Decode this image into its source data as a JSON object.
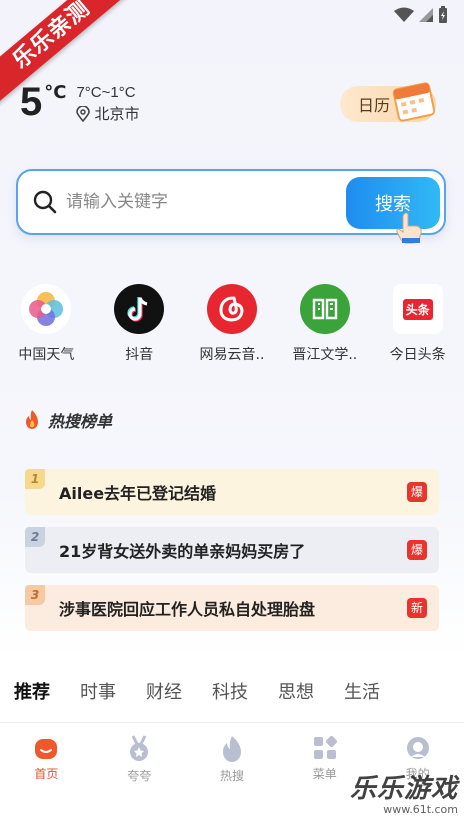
{
  "ribbon": {
    "text": "乐乐亲测"
  },
  "weather": {
    "temp": "5",
    "unit": "°C",
    "range": "7°C~1°C",
    "city": "北京市"
  },
  "calendar": {
    "label": "日历"
  },
  "search": {
    "placeholder": "请输入关键字",
    "button": "搜索"
  },
  "apps": [
    {
      "label": "中国天气",
      "icon": "china-weather-icon"
    },
    {
      "label": "抖音",
      "icon": "douyin-icon"
    },
    {
      "label": "网易云音..",
      "icon": "netease-music-icon"
    },
    {
      "label": "晋江文学..",
      "icon": "jinjiang-icon"
    },
    {
      "label": "今日头条",
      "icon": "toutiao-icon",
      "badge": "头条"
    }
  ],
  "hot": {
    "title": "热搜榜单",
    "items": [
      {
        "rank": "1",
        "text": "Ailee去年已登记结婚",
        "tag": "爆"
      },
      {
        "rank": "2",
        "text": "21岁背女送外卖的单亲妈妈买房了",
        "tag": "爆"
      },
      {
        "rank": "3",
        "text": "涉事医院回应工作人员私自处理胎盘",
        "tag": "新"
      }
    ]
  },
  "tabs": [
    "推荐",
    "时事",
    "财经",
    "科技",
    "思想",
    "生活"
  ],
  "nav": [
    {
      "label": "首页",
      "icon": "home-icon",
      "active": true
    },
    {
      "label": "夸夸",
      "icon": "medal-icon"
    },
    {
      "label": "热搜",
      "icon": "flame-icon"
    },
    {
      "label": "菜单",
      "icon": "grid-menu-icon"
    },
    {
      "label": "我的",
      "icon": "profile-icon"
    }
  ],
  "watermark": {
    "main": "乐乐游戏",
    "url": "www.61t.com"
  },
  "colors": {
    "accent": "#e8502c",
    "search_blue": "#1f8cf0",
    "hot_tag": "#e8342c"
  }
}
